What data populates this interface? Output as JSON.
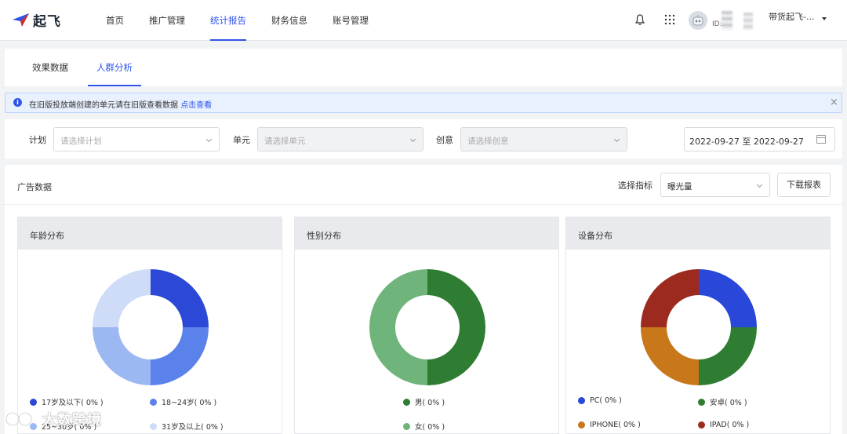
{
  "app": {
    "logo_text": "起飞"
  },
  "nav": {
    "items": [
      "首页",
      "推广管理",
      "统计报告",
      "财务信息",
      "账号管理"
    ],
    "active_index": 2
  },
  "user": {
    "id_label": "ID:",
    "name": "带货起飞-..."
  },
  "subtabs": {
    "items": [
      "效果数据",
      "人群分析"
    ],
    "active_index": 1
  },
  "notice": {
    "text": "在旧版投放端创建的单元请在旧版查看数据",
    "link": "点击查看"
  },
  "filters": {
    "plan_label": "计划",
    "plan_placeholder": "请选择计划",
    "unit_label": "单元",
    "unit_placeholder": "请选择单元",
    "creative_label": "创意",
    "creative_placeholder": "请选择创意",
    "date_range": "2022-09-27 至 2022-09-27"
  },
  "main": {
    "title": "广告数据",
    "metric_label": "选择指标",
    "metric_value": "曝光量",
    "download_label": "下载报表"
  },
  "cards": {
    "age": {
      "title": "年龄分布",
      "legend": [
        "17岁及以下( 0% )",
        "18~24岁( 0% )",
        "25~30岁( 0% )",
        "31岁及以上( 0% )"
      ]
    },
    "gender": {
      "title": "性别分布",
      "legend": [
        "男( 0% )",
        "女( 0% )"
      ]
    },
    "device": {
      "title": "设备分布",
      "legend": [
        "PC( 0% )",
        "安卓( 0% )",
        "IPHONE( 0% )",
        "IPAD( 0% )"
      ]
    }
  },
  "chart_data": [
    {
      "type": "pie",
      "title": "年龄分布",
      "categories": [
        "17岁及以下",
        "18~24岁",
        "25~30岁",
        "31岁及以上"
      ],
      "values": [
        0,
        0,
        0,
        0
      ],
      "colors": [
        "#2b49d6",
        "#5b82ea",
        "#9bb8f3",
        "#cfdcf8"
      ]
    },
    {
      "type": "pie",
      "title": "性别分布",
      "categories": [
        "男",
        "女"
      ],
      "values": [
        0,
        0
      ],
      "colors": [
        "#2e7d32",
        "#6fb47a"
      ]
    },
    {
      "type": "pie",
      "title": "设备分布",
      "categories": [
        "PC",
        "安卓",
        "IPHONE",
        "IPAD"
      ],
      "values": [
        0,
        0,
        0,
        0
      ],
      "colors": [
        "#2947d8",
        "#2e7d32",
        "#c8771a",
        "#9c2a1e"
      ]
    }
  ],
  "watermark": {
    "text": "大数跨境"
  },
  "theme": {
    "accent": "#2f54eb"
  }
}
